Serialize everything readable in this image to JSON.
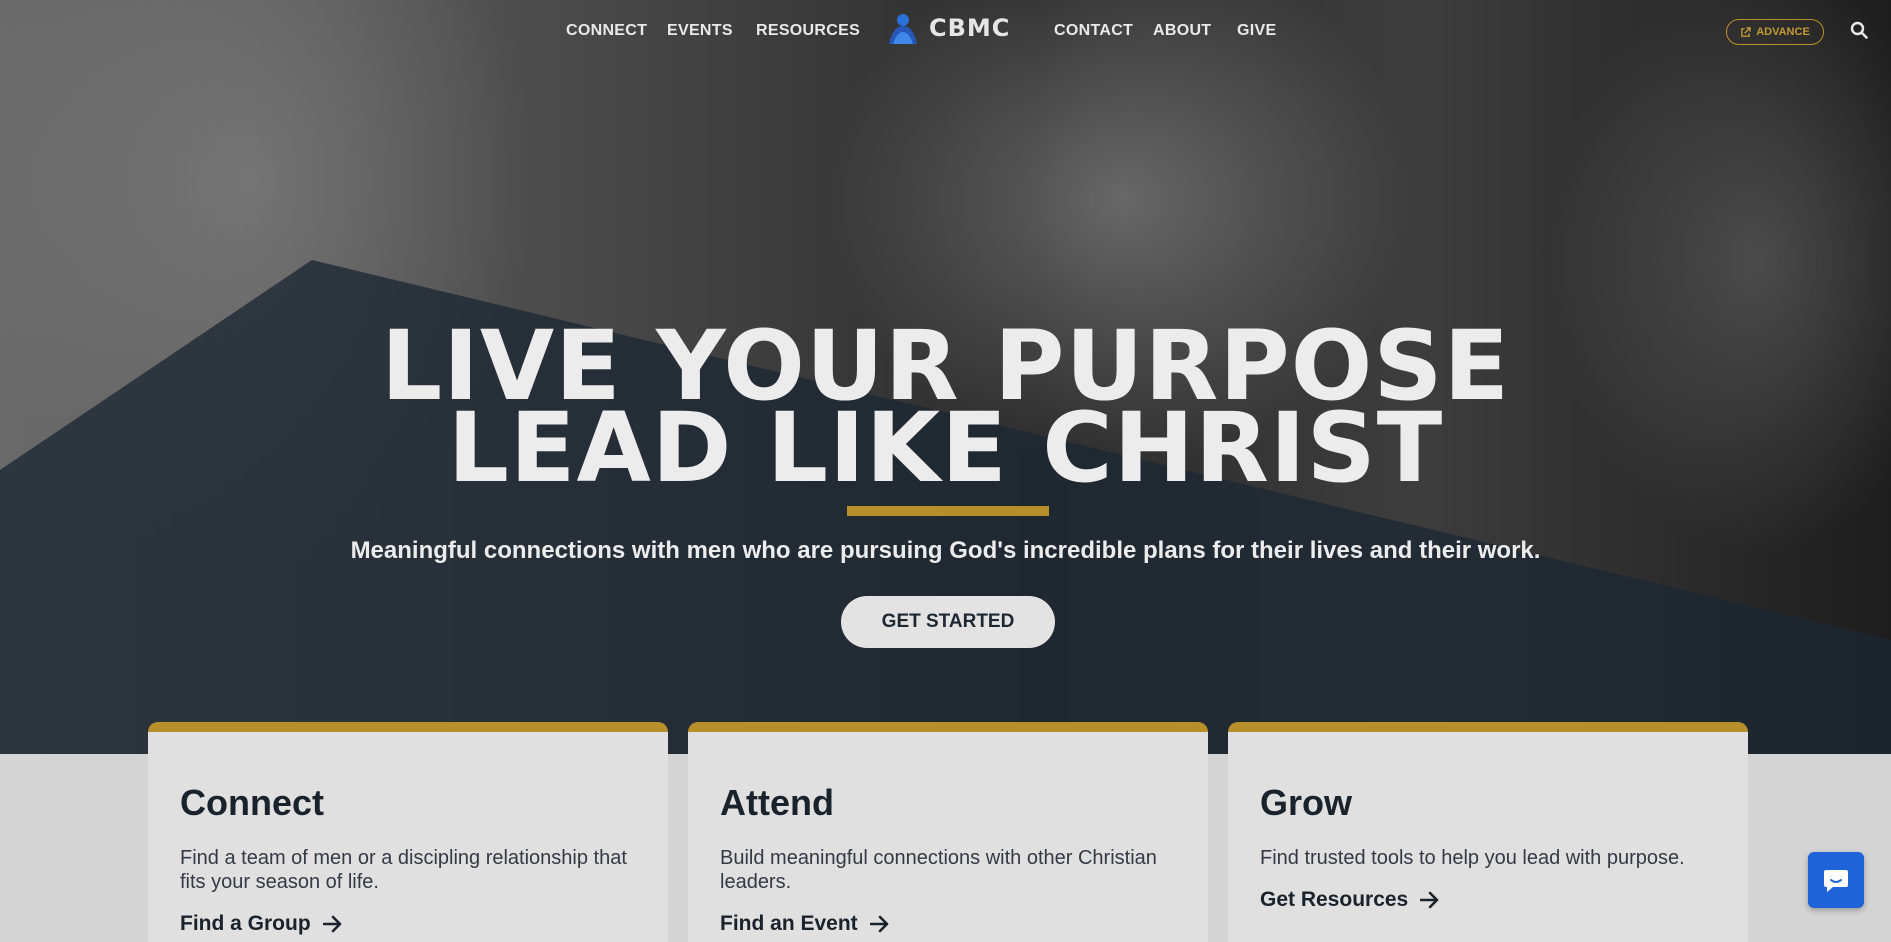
{
  "nav": {
    "left_items": [
      "CONNECT",
      "EVENTS",
      "RESOURCES"
    ],
    "right_items": [
      "CONTACT",
      "ABOUT",
      "GIVE"
    ],
    "logo_text": "CBMC",
    "advance_label": "ADVANCE"
  },
  "hero": {
    "headline_line1": "LIVE YOUR PURPOSE",
    "headline_line2": "LEAD LIKE CHRIST",
    "tagline": "Meaningful connections with men who are pursuing God's incredible plans for their lives and their work.",
    "cta_label": "GET STARTED"
  },
  "cards": [
    {
      "title": "Connect",
      "description": "Find a team of men or a discipling relationship that fits your season of life.",
      "link": "Find a Group"
    },
    {
      "title": "Attend",
      "description": "Build meaningful connections with other Christian leaders.",
      "link": "Find an Event"
    },
    {
      "title": "Grow",
      "description": "Find trusted tools to help you lead with purpose.",
      "link": "Get Resources"
    }
  ],
  "colors": {
    "accent_gold": "#b8902b",
    "overlay_navy": "#1f2a38",
    "chat_blue": "#2062d8"
  },
  "icons": [
    "external-link-icon",
    "search-icon",
    "arrow-right-icon",
    "chat-icon"
  ]
}
